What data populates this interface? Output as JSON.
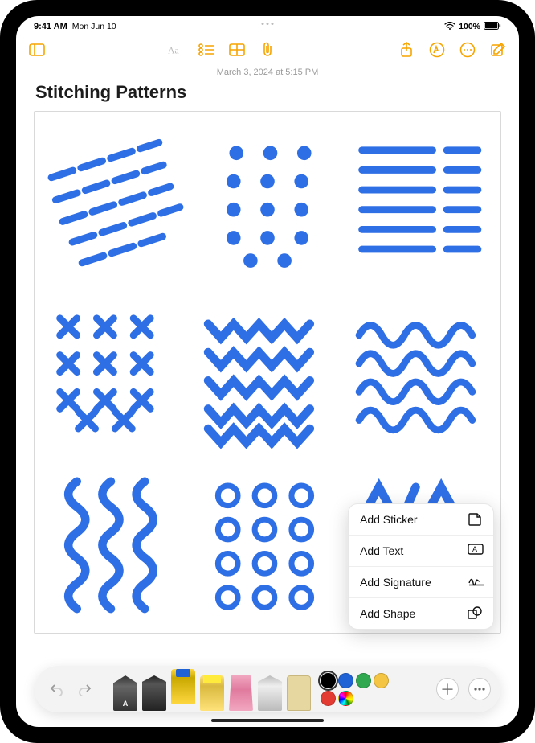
{
  "status": {
    "time": "9:41 AM",
    "date": "Mon Jun 10",
    "battery_pct": "100%"
  },
  "toolbar": {
    "sidebar_icon": "sidebar-icon",
    "format_icon": "text-format-icon",
    "checklist_icon": "checklist-icon",
    "table_icon": "table-icon",
    "attach_icon": "attachment-icon",
    "share_icon": "share-icon",
    "markup_icon": "markup-icon",
    "more_icon": "more-icon",
    "compose_icon": "compose-icon"
  },
  "note": {
    "timestamp": "March 3, 2024 at 5:15 PM",
    "title": "Stitching Patterns"
  },
  "popover": {
    "items": [
      {
        "label": "Add Sticker",
        "icon": "sticker-icon"
      },
      {
        "label": "Add Text",
        "icon": "textbox-icon"
      },
      {
        "label": "Add Signature",
        "icon": "signature-icon"
      },
      {
        "label": "Add Shape",
        "icon": "shape-icon"
      }
    ]
  },
  "palette": {
    "undo": "undo-icon",
    "redo": "redo-icon",
    "tools": [
      {
        "name": "handwriting-pen",
        "selected": false
      },
      {
        "name": "fine-pen",
        "selected": false
      },
      {
        "name": "marker",
        "selected": true
      },
      {
        "name": "highlighter",
        "selected": false
      },
      {
        "name": "eraser",
        "selected": false
      },
      {
        "name": "pencil",
        "selected": false
      },
      {
        "name": "ruler",
        "selected": false
      }
    ],
    "colors": [
      {
        "name": "black",
        "hex": "#000000",
        "selected": true
      },
      {
        "name": "blue",
        "hex": "#1e62d6",
        "selected": false
      },
      {
        "name": "green",
        "hex": "#2fa84f",
        "selected": false
      },
      {
        "name": "yellow",
        "hex": "#f4c542",
        "selected": false
      },
      {
        "name": "red",
        "hex": "#e33b32",
        "selected": false
      },
      {
        "name": "picker",
        "hex": "conic",
        "selected": false
      }
    ],
    "add": "add-icon",
    "more": "ellipsis-icon"
  },
  "drawing_color": "#2f6fe6"
}
